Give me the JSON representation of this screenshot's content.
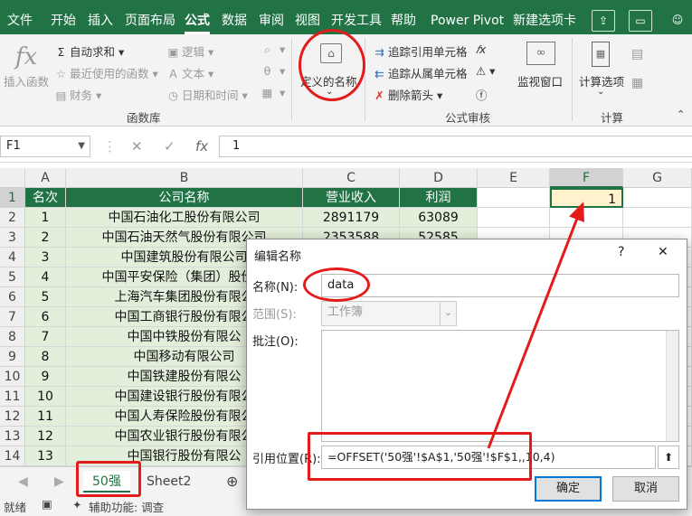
{
  "tabs": [
    "文件",
    "开始",
    "插入",
    "页面布局",
    "公式",
    "数据",
    "审阅",
    "视图",
    "开发工具",
    "帮助",
    "Power Pivot",
    "新建选项卡"
  ],
  "active_tab": "公式",
  "ribbon": {
    "insert_function": "插入函数",
    "autosum": "自动求和",
    "recent": "最近使用的函数",
    "finance": "财务",
    "logic": "逻辑",
    "text": "文本",
    "datetime": "日期和时间",
    "group_funclib": "函数库",
    "defined_names": "定义的名称",
    "trace_precedents": "追踪引用单元格",
    "trace_dependents": "追踪从属单元格",
    "remove_arrows": "删除箭头",
    "watch_window": "监视窗口",
    "group_audit": "公式审核",
    "calc_options": "计算选项",
    "group_calc": "计算"
  },
  "formula_bar": {
    "name_box": "F1",
    "value": "1"
  },
  "columns": [
    "A",
    "B",
    "C",
    "D",
    "E",
    "F",
    "G"
  ],
  "header_row": [
    "名次",
    "公司名称",
    "营业收入",
    "利润"
  ],
  "rows": [
    {
      "n": "1",
      "rank": "1",
      "company": "中国石油化工股份有限公司",
      "revenue": "2891179",
      "profit": "63089"
    },
    {
      "n": "2",
      "rank": "2",
      "company": "中国石油天然气股份有限公司",
      "revenue": "2353588",
      "profit": "52585"
    },
    {
      "n": "3",
      "rank": "3",
      "company": "中国建筑股份有限公司",
      "revenue": "",
      "profit": ""
    },
    {
      "n": "4",
      "rank": "4",
      "company": "中国平安保险（集团）股份有",
      "revenue": "",
      "profit": ""
    },
    {
      "n": "5",
      "rank": "5",
      "company": "上海汽车集团股份有限公",
      "revenue": "",
      "profit": ""
    },
    {
      "n": "6",
      "rank": "6",
      "company": "中国工商银行股份有限公",
      "revenue": "",
      "profit": ""
    },
    {
      "n": "7",
      "rank": "7",
      "company": "中国中铁股份有限公",
      "revenue": "",
      "profit": ""
    },
    {
      "n": "8",
      "rank": "8",
      "company": "中国移动有限公司",
      "revenue": "",
      "profit": ""
    },
    {
      "n": "9",
      "rank": "9",
      "company": "中国铁建股份有限公",
      "revenue": "",
      "profit": ""
    },
    {
      "n": "10",
      "rank": "10",
      "company": "中国建设银行股份有限公",
      "revenue": "",
      "profit": ""
    },
    {
      "n": "11",
      "rank": "11",
      "company": "中国人寿保险股份有限公",
      "revenue": "",
      "profit": ""
    },
    {
      "n": "12",
      "rank": "12",
      "company": "中国农业银行股份有限公",
      "revenue": "",
      "profit": ""
    },
    {
      "n": "13",
      "rank": "13",
      "company": "中国银行股份有限公",
      "revenue": "",
      "profit": ""
    }
  ],
  "f1_value": "1",
  "row_header_1": "1",
  "sheets": [
    "50强",
    "Sheet2"
  ],
  "active_sheet": "50强",
  "status": {
    "ready": "就绪",
    "accessibility": "辅助功能: 调查"
  },
  "dialog": {
    "title": "编辑名称",
    "help": "?",
    "close": "✕",
    "name_label": "名称(N):",
    "name_value": "data",
    "scope_label": "范围(S):",
    "scope_value": "工作簿",
    "comment_label": "批注(O):",
    "ref_label": "引用位置(R):",
    "ref_value": "=OFFSET('50强'!$A$1,'50强'!$F$1,,10,4)",
    "ok": "确定",
    "cancel": "取消"
  },
  "colors": {
    "excel_green": "#217346",
    "light_green": "#e2efda",
    "highlight_yellow": "#fff2cc",
    "annotation_red": "#e31b1b"
  }
}
